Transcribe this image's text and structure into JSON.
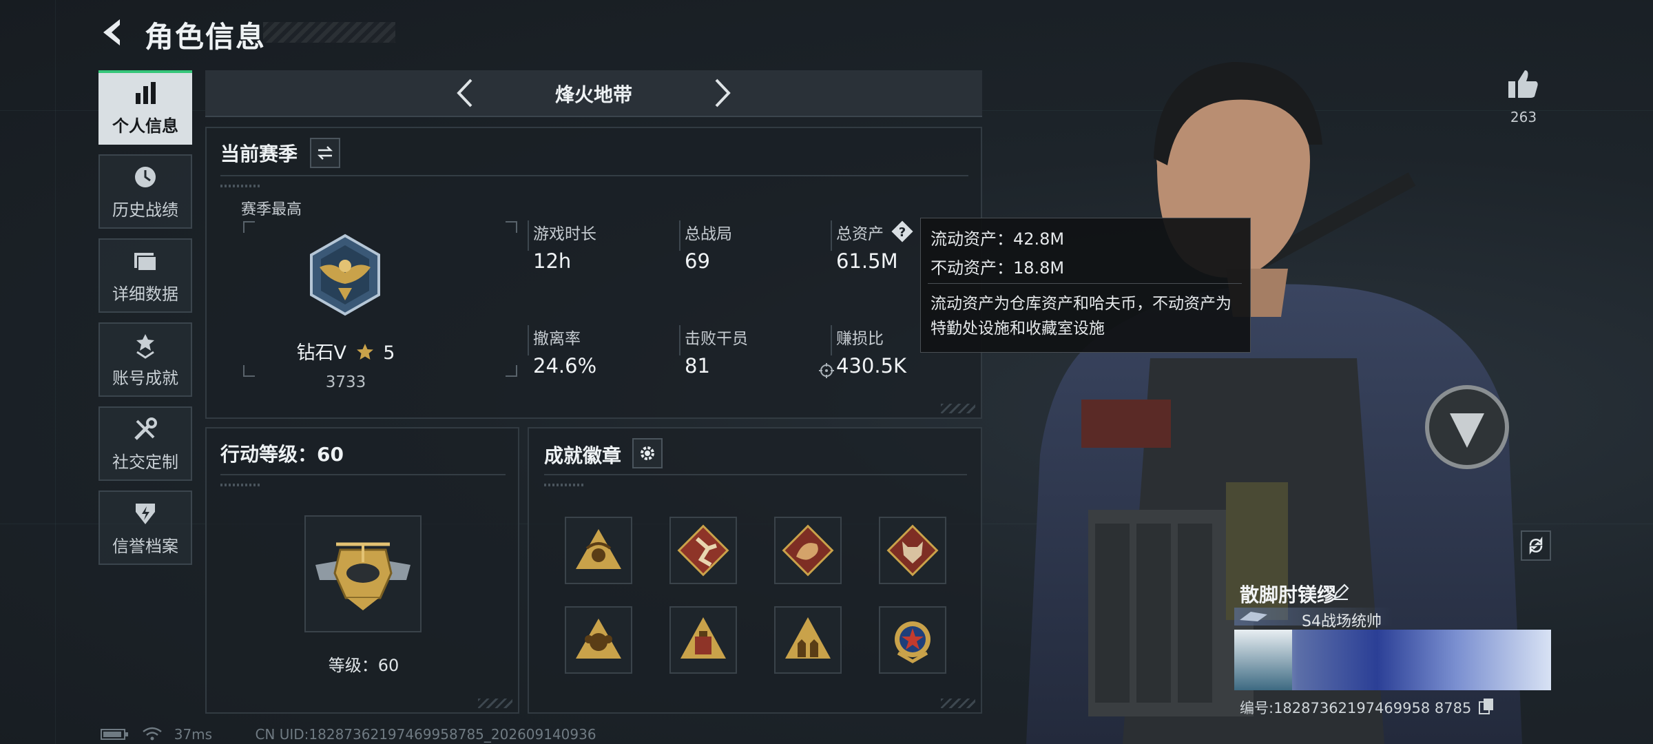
{
  "header": {
    "title": "角色信息"
  },
  "sidebar": {
    "items": [
      {
        "label": "个人信息",
        "icon": "bar-chart-icon",
        "active": true
      },
      {
        "label": "历史战绩",
        "icon": "clock-icon"
      },
      {
        "label": "详细数据",
        "icon": "folder-icon"
      },
      {
        "label": "账号成就",
        "icon": "achievement-icon"
      },
      {
        "label": "社交定制",
        "icon": "tools-icon"
      },
      {
        "label": "信誉档案",
        "icon": "shield-bolt-icon"
      }
    ]
  },
  "mode": {
    "title": "烽火地带"
  },
  "season": {
    "title": "当前赛季",
    "best_label": "赛季最高",
    "rank_name": "钻石V",
    "rank_stars": "5",
    "rank_points": "3733",
    "stats": [
      {
        "label": "游戏时长",
        "value": "12h"
      },
      {
        "label": "总战局",
        "value": "69"
      },
      {
        "label": "总资产",
        "value": "61.5M"
      },
      {
        "label": "撤离率",
        "value": "24.6%"
      },
      {
        "label": "击败干员",
        "value": "81"
      },
      {
        "label": "赚损比",
        "value": "430.5K"
      }
    ]
  },
  "tooltip": {
    "liquid": "流动资产：42.8M",
    "fixed": "不动资产：18.8M",
    "desc": "流动资产为仓库资产和哈夫币，不动资产为特勤处设施和收藏室设施"
  },
  "level": {
    "title": "行动等级：60",
    "caption": "等级：60"
  },
  "badges": {
    "title": "成就徽章",
    "items": [
      "scorpion-badge",
      "runner-badge",
      "dragon-badge",
      "wolf-badge",
      "monkey-badge",
      "bag-badge",
      "soldiers-badge",
      "star-emblem-badge"
    ]
  },
  "player": {
    "likes": "263",
    "nickname": "散脚肘镁缪",
    "card_title": "S4战场统帅",
    "id_text": "编号:18287362197469958 8785"
  },
  "status": {
    "ping": "37ms",
    "uid": "CN UID:18287362197469958785_202609140936"
  },
  "colors": {
    "accent": "#36c67a",
    "panel": "#1a2026",
    "gold": "#c9a24a"
  }
}
